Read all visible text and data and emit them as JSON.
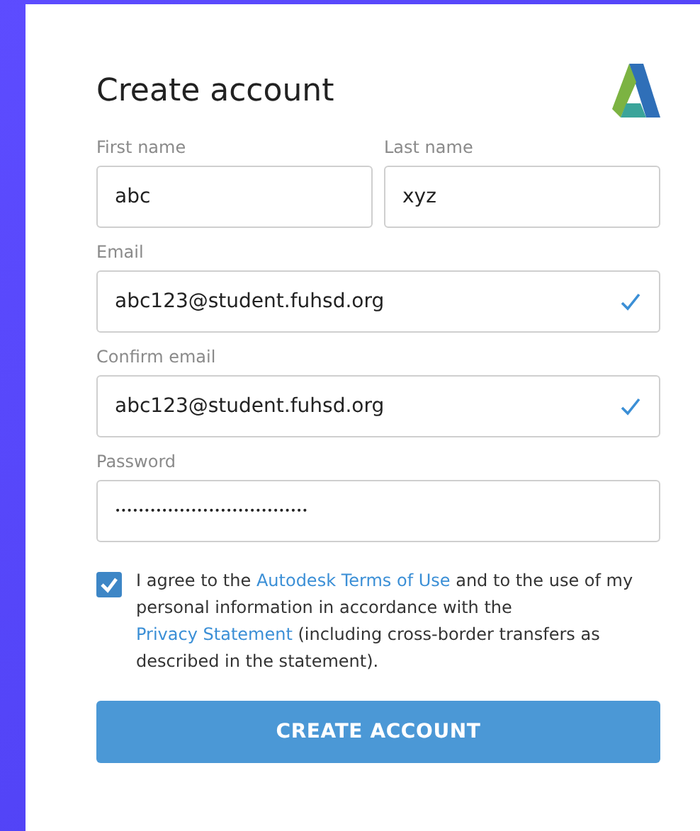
{
  "title": "Create account",
  "name_fields": [
    {
      "label": "First name",
      "value": "abc"
    },
    {
      "label": "Last name",
      "value": "xyz"
    }
  ],
  "fields": [
    {
      "kind": "text",
      "label": "Email",
      "value": "abc123@student.fuhsd.org",
      "valid": true
    },
    {
      "kind": "text",
      "label": "Confirm email",
      "value": "abc123@student.fuhsd.org",
      "valid": true
    },
    {
      "kind": "password",
      "label": "Password",
      "value": "•••••••••••••••••••••••••••••••••"
    }
  ],
  "agreement": {
    "checked": true,
    "segments": [
      {
        "kind": "text",
        "text": "I agree to the "
      },
      {
        "kind": "link",
        "text": "Autodesk Terms of Use"
      },
      {
        "kind": "text",
        "text": " and to the use of my personal information in accordance with the "
      },
      {
        "kind": "link",
        "text": "Privacy Statement"
      },
      {
        "kind": "text",
        "text": " (including cross-border transfers as described in the statement)."
      }
    ]
  },
  "button": "CREATE ACCOUNT"
}
